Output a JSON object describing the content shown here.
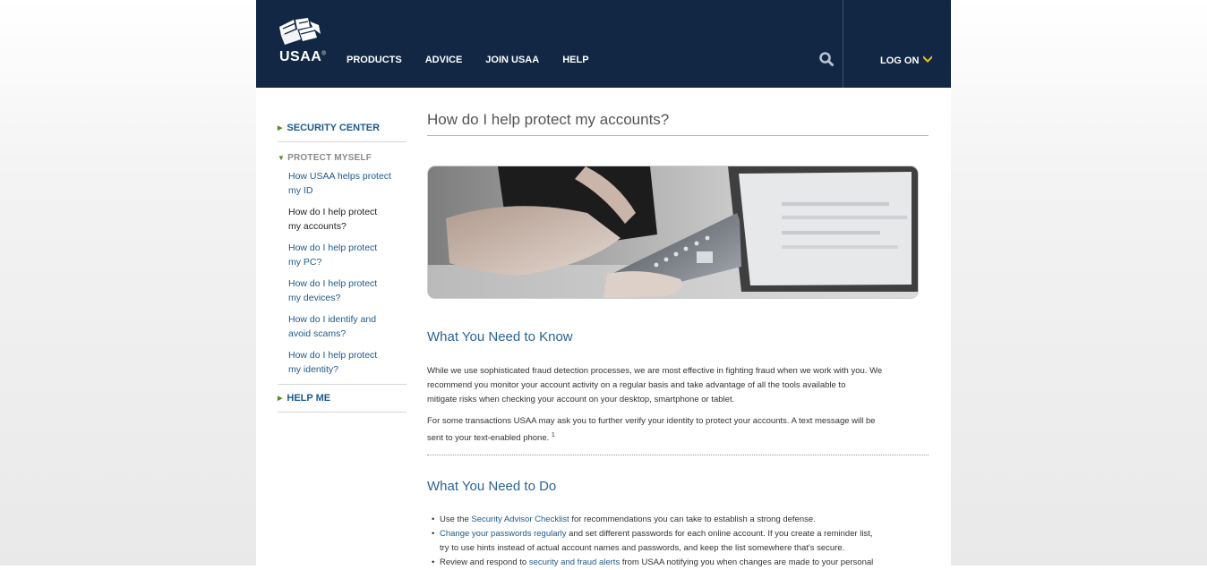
{
  "header": {
    "logo_text": "USAA",
    "logo_mark": "®",
    "nav": [
      "PRODUCTS",
      "ADVICE",
      "JOIN USAA",
      "HELP"
    ],
    "log_on": "LOG ON",
    "colors": {
      "header_bg": "#112744",
      "accent": "#e8b820"
    }
  },
  "sidebar": {
    "security_center": "SECURITY CENTER",
    "protect_myself": "PROTECT MYSELF",
    "links": [
      {
        "line1": "How USAA helps protect",
        "line2": "my ID"
      },
      {
        "line1": "How do I help protect",
        "line2": "my accounts?"
      },
      {
        "line1": "How do I help protect",
        "line2": "my PC?"
      },
      {
        "line1": "How do I help protect",
        "line2": "my devices?"
      },
      {
        "line1": "How do I identify and",
        "line2": "avoid scams?"
      },
      {
        "line1": "How do I help protect",
        "line2": "my identity?"
      }
    ],
    "help_me": "HELP ME"
  },
  "main": {
    "title": "How do I help protect my accounts?",
    "know_heading": "What You Need to Know",
    "p1": [
      "While we use sophisticated fraud detection processes, we are most effective in fighting fraud when we work with you. We",
      "recommend you monitor your account activity on a regular basis and take advantage of all the tools available to",
      "mitigate risks when checking your account on your desktop, smartphone or tablet."
    ],
    "p2_line1": "For some transactions USAA may ask you to further verify your identity to protect your accounts. A text message will be",
    "p2_line2": "sent to your text-enabled phone.",
    "footnote": "1",
    "do_heading": "What You Need to Do",
    "bullet1": {
      "pre": "Use the ",
      "link": "Security Advisor Checklist",
      "post": " for recommendations you can take to establish a strong defense."
    },
    "bullet2": {
      "link": "Change your passwords regularly",
      "post": " and set different passwords for each online account. If you create a reminder list,",
      "line2": "try to use hints instead of actual account names and passwords, and keep the list somewhere that's secure."
    },
    "bullet3": {
      "pre": "Review and respond to ",
      "link": "security and fraud alerts",
      "post": " from USAA notifying you when changes are made to your personal"
    }
  }
}
